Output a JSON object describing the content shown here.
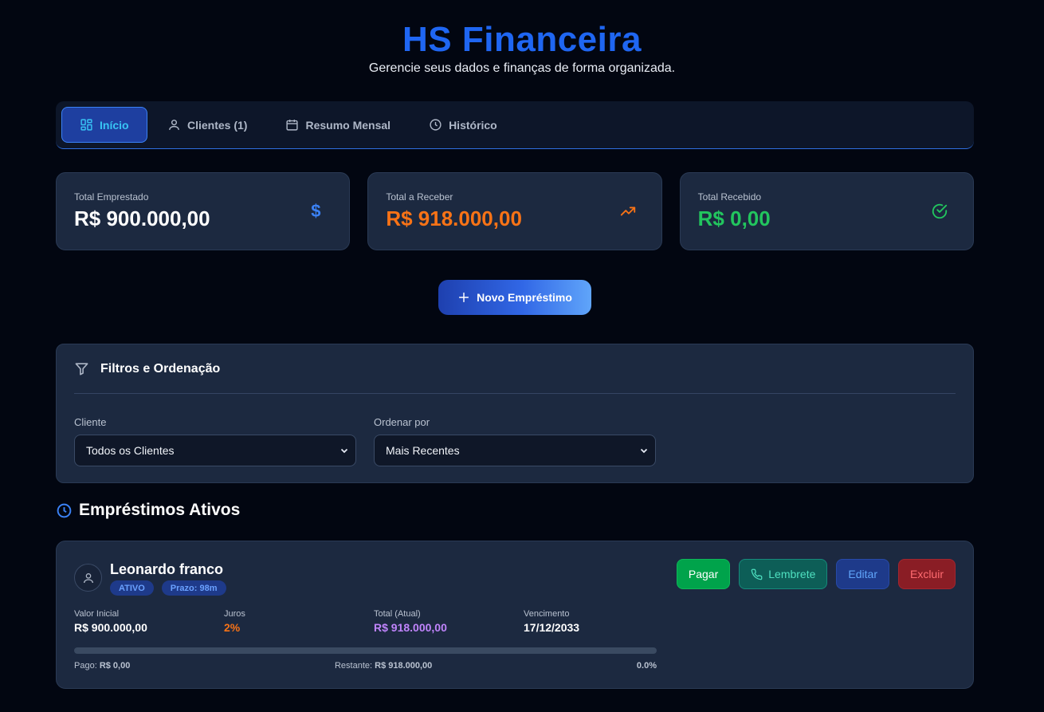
{
  "header": {
    "title": "HS Financeira",
    "subtitle": "Gerencie seus dados e finanças de forma organizada."
  },
  "nav": {
    "tabs": [
      {
        "label": "Início",
        "icon": "dashboard-icon",
        "active": true
      },
      {
        "label": "Clientes (1)",
        "icon": "user-icon",
        "active": false
      },
      {
        "label": "Resumo Mensal",
        "icon": "calendar-icon",
        "active": false
      },
      {
        "label": "Histórico",
        "icon": "clock-icon",
        "active": false
      }
    ]
  },
  "summary": {
    "lent": {
      "label": "Total Emprestado",
      "value": "R$ 900.000,00",
      "icon": "dollar-icon",
      "color": "#ffffff",
      "icon_color": "#3b82f6"
    },
    "receivable": {
      "label": "Total a Receber",
      "value": "R$ 918.000,00",
      "icon": "trending-up-icon",
      "color": "#f97316",
      "icon_color": "#f97316"
    },
    "received": {
      "label": "Total Recebido",
      "value": "R$ 0,00",
      "icon": "check-circle-icon",
      "color": "#22c55e",
      "icon_color": "#22c55e"
    }
  },
  "new_loan_label": "Novo Empréstimo",
  "filters": {
    "title": "Filtros e Ordenação",
    "client_label": "Cliente",
    "client_value": "Todos os Clientes",
    "sort_label": "Ordenar por",
    "sort_value": "Mais Recentes"
  },
  "active_loans": {
    "title": "Empréstimos Ativos",
    "items": [
      {
        "client": "Leonardo franco",
        "status": "ATIVO",
        "term": "Prazo: 98m",
        "actions": {
          "pay": "Pagar",
          "remind": "Lembrete",
          "edit": "Editar",
          "delete": "Excluir"
        },
        "initial_label": "Valor Inicial",
        "initial_value": "R$ 900.000,00",
        "interest_label": "Juros",
        "interest_value": "2%",
        "total_label": "Total (Atual)",
        "total_value": "R$ 918.000,00",
        "due_label": "Vencimento",
        "due_value": "17/12/2033",
        "paid_label": "Pago:",
        "paid_value": "R$ 0,00",
        "remaining_label": "Restante:",
        "remaining_value": "R$ 918.000,00",
        "progress_text": "0.0%",
        "progress": 0.0
      }
    ]
  },
  "colors": {
    "accent": "#1f66f2",
    "background": "#020611",
    "card": "#1c2940",
    "interest": "#f97316",
    "total": "#c084fc"
  }
}
